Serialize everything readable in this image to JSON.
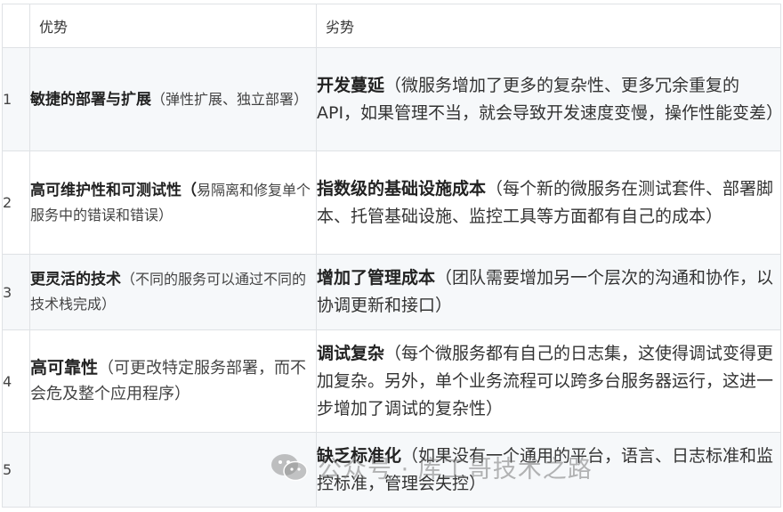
{
  "table": {
    "header": {
      "index": "",
      "advantages": "优势",
      "disadvantages": "劣势"
    },
    "rows": [
      {
        "index": "1",
        "adv_title": "敏捷的部署与扩展",
        "adv_desc": "（弹性扩展、独立部署）",
        "dis_title": "开发蔓延",
        "dis_desc": "（微服务增加了更多的复杂性、更多冗余重复的API，如果管理不当，就会导致开发速度变慢，操作性能变差）"
      },
      {
        "index": "2",
        "adv_title": "高可维护性和可测试性（",
        "adv_desc": "易隔离和修复单个服务中的错误和错误）",
        "dis_title": "指数级的基础设施成本",
        "dis_desc": "（每个新的微服务在测试套件、部署脚本、托管基础设施、监控工具等方面都有自己的成本）"
      },
      {
        "index": "3",
        "adv_title": "更灵活的技术",
        "adv_desc": "（不同的服务可以通过不同的技术栈完成）",
        "dis_title": "增加了管理成本",
        "dis_desc": "（团队需要增加另一个层次的沟通和协作，以协调更新和接口）"
      },
      {
        "index": "4",
        "adv_title": "高可靠性",
        "adv_desc": "（可更改特定服务部署，而不会危及整个应用程序）",
        "dis_title": "调试复杂",
        "dis_desc": "（每个微服务都有自己的日志集，这使得调试变得更加复杂。另外，单个业务流程可以跨多台服务器运行，这进一步增加了调试的复杂性）"
      },
      {
        "index": "5",
        "adv_title": "",
        "adv_desc": "",
        "dis_title": "缺乏标准化",
        "dis_desc": "（如果没有一个通用的平台，语言、日志标准和监控标准，管理会失控）"
      }
    ]
  },
  "watermark": {
    "icon": "wechat-icon",
    "text": "公众号 · 库工哥技术之路"
  }
}
